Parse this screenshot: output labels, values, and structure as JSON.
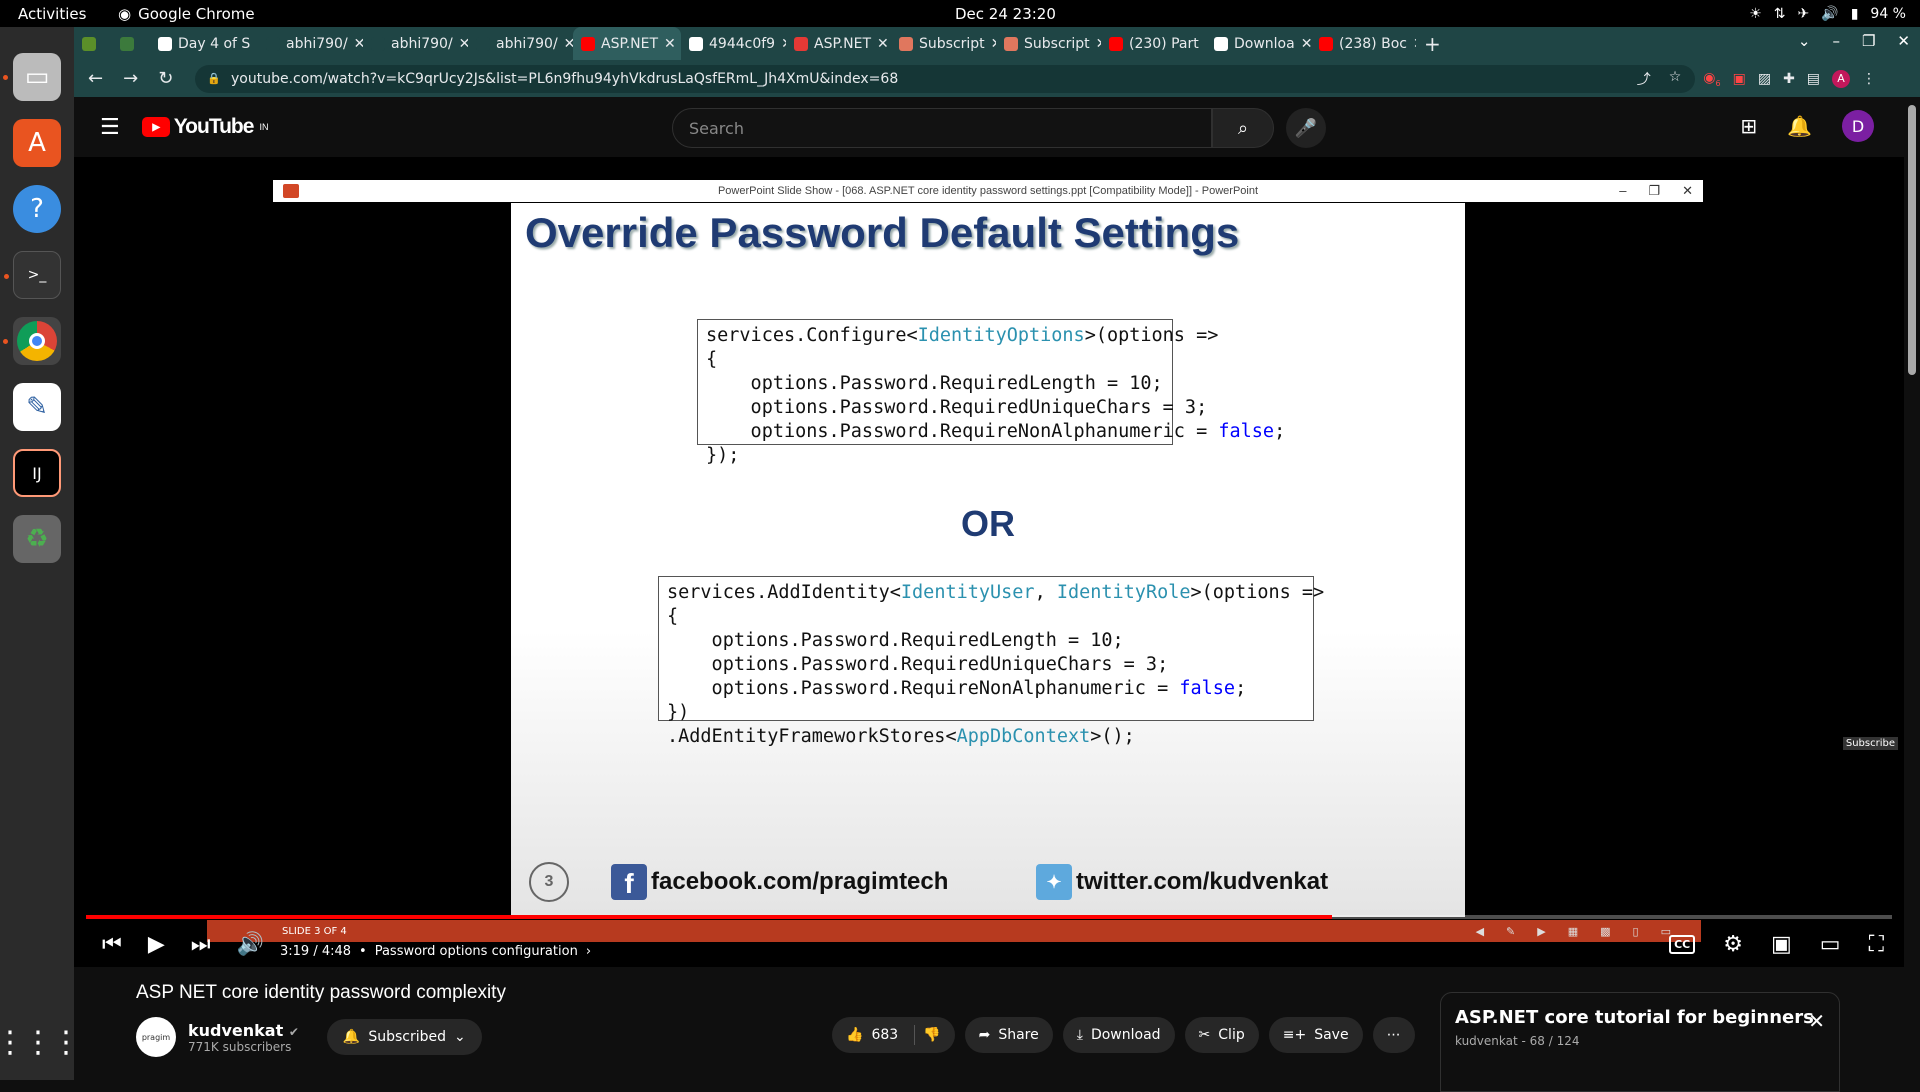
{
  "os": {
    "activities": "Activities",
    "app_name": "Google Chrome",
    "clock": "Dec 24  23:20",
    "battery": "94 %"
  },
  "tabs": [
    {
      "label": "",
      "color": "#5b8f29"
    },
    {
      "label": "",
      "color": "#3c7a3c"
    },
    {
      "label": "Day 4 of S",
      "color": "#ffffff"
    },
    {
      "label": "abhi790/",
      "color": "#1f4545"
    },
    {
      "label": "abhi790/",
      "color": "#1f4545"
    },
    {
      "label": "abhi790/",
      "color": "#1f4545"
    },
    {
      "label": "ASP.NET",
      "color": "#ff0000"
    },
    {
      "label": "4944c0f9",
      "color": "#ffffff"
    },
    {
      "label": "ASP.NET",
      "color": "#e53935"
    },
    {
      "label": "Subscript",
      "color": "#e0775e"
    },
    {
      "label": "Subscript",
      "color": "#e0775e"
    },
    {
      "label": "(230) Part",
      "color": "#ff0000"
    },
    {
      "label": "Downloa",
      "color": "#ffffff"
    },
    {
      "label": "(238) Boc",
      "color": "#ff0000"
    }
  ],
  "address": {
    "url": "youtube.com/watch?v=kC9qrUcy2Js&list=PL6n9fhu94yhVkdrusLaQsfERmL_Jh4XmU&index=68",
    "ext_badge": "6",
    "profile": "A"
  },
  "youtube": {
    "logo_text": "YouTube",
    "region": "IN",
    "search_placeholder": "Search",
    "avatar": "D"
  },
  "powerpoint": {
    "window_title": "PowerPoint Slide Show - [068. ASP.NET core identity password settings.ppt [Compatibility Mode]] - PowerPoint",
    "slide_title": "Override Password Default Settings",
    "or_text": "OR",
    "slide_number": "3",
    "facebook": "facebook.com/pragimtech",
    "twitter": "twitter.com/kudvenkat",
    "nav_label": "SLIDE 3 OF 4"
  },
  "player": {
    "watermark": "Subscribe",
    "time": "3:19 / 4:48",
    "chapter": "Password options configuration",
    "progress": 0.69
  },
  "video": {
    "title": "ASP NET core identity password complexity",
    "channel": "kudvenkat",
    "subscribers": "771K subscribers",
    "subscribed_label": "Subscribed",
    "likes": "683",
    "share": "Share",
    "download": "Download",
    "clip": "Clip",
    "save": "Save"
  },
  "playlist": {
    "title": "ASP.NET core tutorial for beginners",
    "subtitle": "kudvenkat - 68 / 124"
  },
  "colors": {
    "chrome_frame": "#1f4545",
    "youtube_red": "#ff0000",
    "slide_title": "#1f3b73",
    "code_type": "#2b91af",
    "code_keyword": "#0000ff"
  }
}
